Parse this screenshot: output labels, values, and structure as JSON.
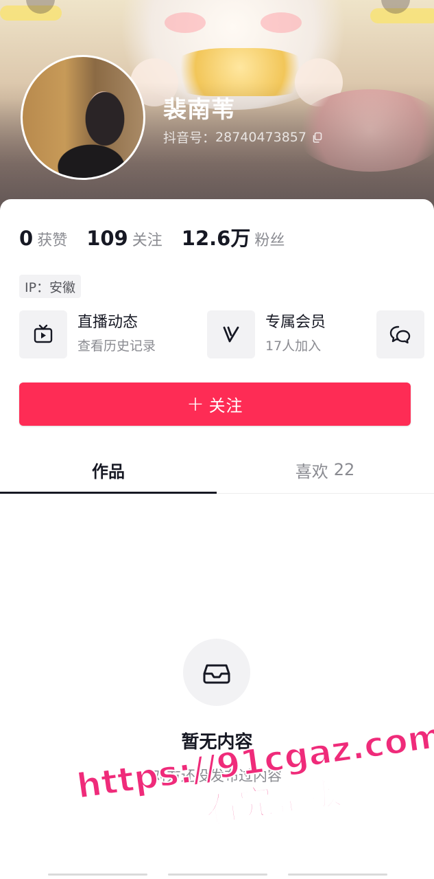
{
  "profile": {
    "name": "裴南苇",
    "id_label": "抖音号：",
    "id_value": "28740473857"
  },
  "stats": [
    {
      "value": "0",
      "label": "获赞"
    },
    {
      "value": "109",
      "label": "关注"
    },
    {
      "value": "12.6万",
      "label": "粉丝"
    }
  ],
  "ip": "IP：安徽",
  "features": {
    "live": {
      "title": "直播动态",
      "subtitle": "查看历史记录",
      "icon": "tv-icon"
    },
    "member": {
      "title": "专属会员",
      "subtitle": "17人加入",
      "icon": "v-icon"
    },
    "chat": {
      "icon": "chat-bubble-icon"
    }
  },
  "follow_button": {
    "plus": "+",
    "label": "关注"
  },
  "tabs": [
    {
      "label": "作品",
      "count": ""
    },
    {
      "label": "喜欢",
      "count": "22"
    }
  ],
  "empty": {
    "title": "暂无内容",
    "subtitle": "对方还没发布过内容",
    "icon": "inbox-icon"
  },
  "watermark": {
    "url": "https://91cgaz.com",
    "tag": "看完整版"
  },
  "colors": {
    "accent": "#fe2c55",
    "text_primary": "#161823",
    "text_secondary": "#8a8b91",
    "watermark": "#ef2b7a"
  }
}
